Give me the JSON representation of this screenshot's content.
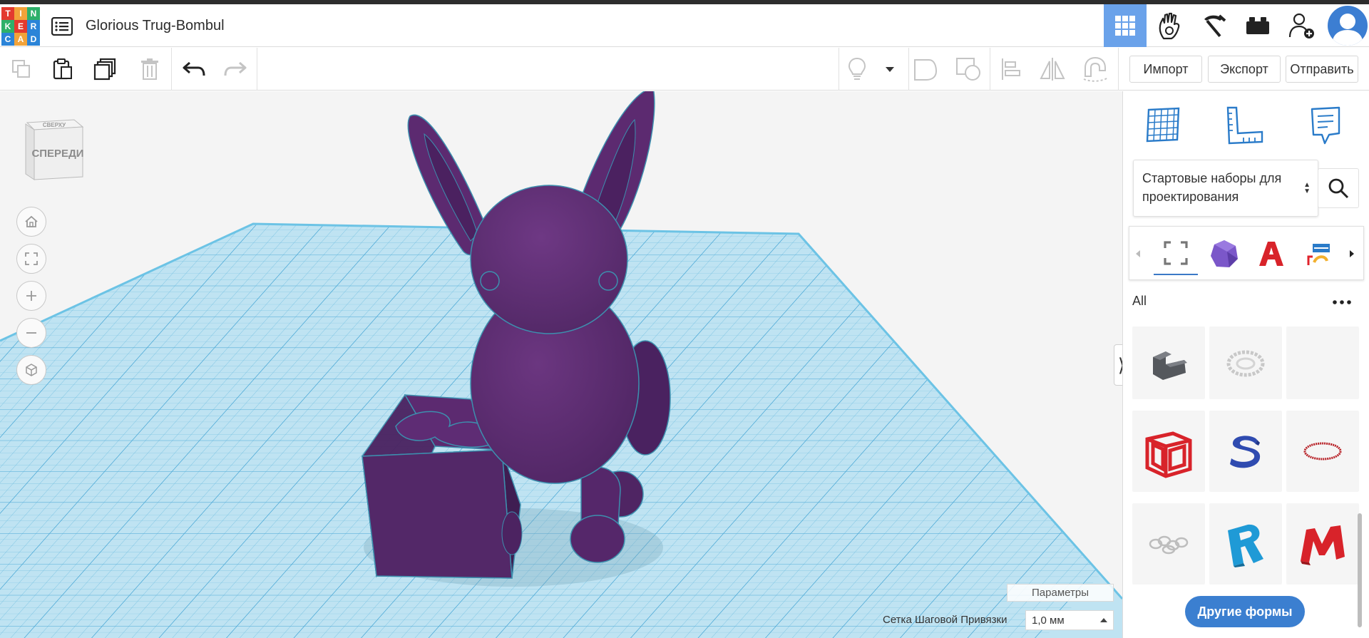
{
  "app": {
    "logo_letters": [
      "T",
      "I",
      "N",
      "K",
      "E",
      "R",
      "C",
      "A",
      "D"
    ],
    "logo_colors": [
      "#e33a2f",
      "#f2a33a",
      "#2eb06a",
      "#2eb06a",
      "#e33a2f",
      "#2b84d8",
      "#2b84d8",
      "#f2a33a",
      "#2b84d8"
    ],
    "design_title": "Glorious Trug-Bombul"
  },
  "header": {
    "modes": [
      {
        "name": "3d-design",
        "icon": "grid-icon",
        "active": true
      },
      {
        "name": "circuits",
        "icon": "glove-icon"
      },
      {
        "name": "codeblocks",
        "icon": "pickaxe-icon"
      },
      {
        "name": "bricks",
        "icon": "brick-icon"
      },
      {
        "name": "invite",
        "icon": "add-user-icon"
      }
    ]
  },
  "toolbar": {
    "import_label": "Импорт",
    "export_label": "Экспорт",
    "send_label": "Отправить"
  },
  "viewport": {
    "view_cube_top": "СВЕРХУ",
    "view_cube_front": "СПЕРЕДИ",
    "params_label": "Параметры",
    "snap_grid_label": "Сетка Шаговой Привязки",
    "snap_grid_value": "1,0 мм"
  },
  "panel": {
    "library_select": "Стартовые наборы для проектирования",
    "section_label": "All",
    "other_shapes_label": "Другие формы",
    "shapes": [
      {
        "name": "shape-bracket",
        "color": "#4a4d52"
      },
      {
        "name": "shape-gear",
        "color": "#d8d8d8"
      },
      {
        "name": "shape-empty",
        "color": ""
      },
      {
        "name": "shape-cube-frame",
        "color": "#e0232b"
      },
      {
        "name": "shape-letter-s",
        "color": "#2f4bb0"
      },
      {
        "name": "shape-ring",
        "color": "#b71f25"
      },
      {
        "name": "shape-chain",
        "color": "#bfbfbf"
      },
      {
        "name": "shape-letter-r",
        "color": "#1f9ad6"
      },
      {
        "name": "shape-letter-m",
        "color": "#d8232a"
      }
    ]
  },
  "colors": {
    "accent": "#3b7fd0",
    "active_mode": "#6aa2ea",
    "grid": "#8fcfe8",
    "model": "#5a2a6e"
  }
}
